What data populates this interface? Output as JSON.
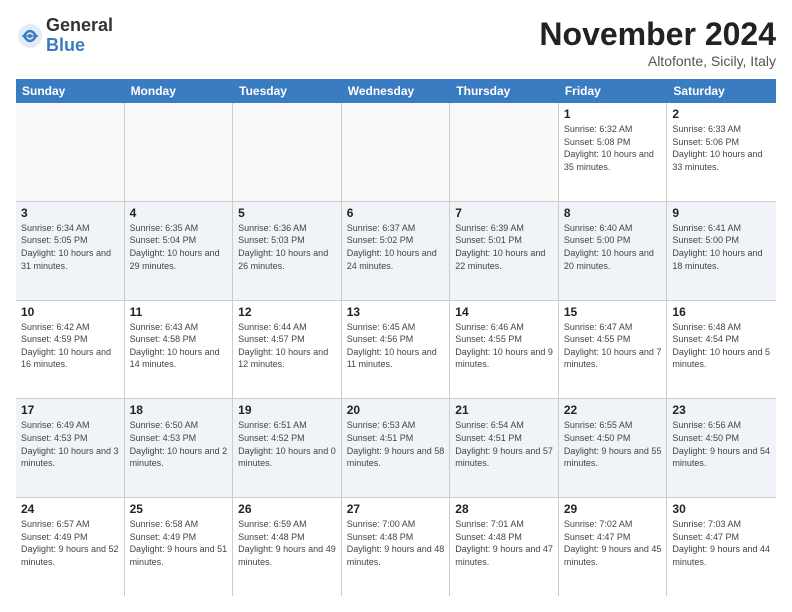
{
  "logo": {
    "general": "General",
    "blue": "Blue"
  },
  "title": "November 2024",
  "location": "Altofonte, Sicily, Italy",
  "weekdays": [
    "Sunday",
    "Monday",
    "Tuesday",
    "Wednesday",
    "Thursday",
    "Friday",
    "Saturday"
  ],
  "rows": [
    [
      {
        "day": "",
        "info": "",
        "empty": true
      },
      {
        "day": "",
        "info": "",
        "empty": true
      },
      {
        "day": "",
        "info": "",
        "empty": true
      },
      {
        "day": "",
        "info": "",
        "empty": true
      },
      {
        "day": "",
        "info": "",
        "empty": true
      },
      {
        "day": "1",
        "info": "Sunrise: 6:32 AM\nSunset: 5:08 PM\nDaylight: 10 hours and 35 minutes.",
        "empty": false
      },
      {
        "day": "2",
        "info": "Sunrise: 6:33 AM\nSunset: 5:06 PM\nDaylight: 10 hours and 33 minutes.",
        "empty": false
      }
    ],
    [
      {
        "day": "3",
        "info": "Sunrise: 6:34 AM\nSunset: 5:05 PM\nDaylight: 10 hours and 31 minutes.",
        "empty": false
      },
      {
        "day": "4",
        "info": "Sunrise: 6:35 AM\nSunset: 5:04 PM\nDaylight: 10 hours and 29 minutes.",
        "empty": false
      },
      {
        "day": "5",
        "info": "Sunrise: 6:36 AM\nSunset: 5:03 PM\nDaylight: 10 hours and 26 minutes.",
        "empty": false
      },
      {
        "day": "6",
        "info": "Sunrise: 6:37 AM\nSunset: 5:02 PM\nDaylight: 10 hours and 24 minutes.",
        "empty": false
      },
      {
        "day": "7",
        "info": "Sunrise: 6:39 AM\nSunset: 5:01 PM\nDaylight: 10 hours and 22 minutes.",
        "empty": false
      },
      {
        "day": "8",
        "info": "Sunrise: 6:40 AM\nSunset: 5:00 PM\nDaylight: 10 hours and 20 minutes.",
        "empty": false
      },
      {
        "day": "9",
        "info": "Sunrise: 6:41 AM\nSunset: 5:00 PM\nDaylight: 10 hours and 18 minutes.",
        "empty": false
      }
    ],
    [
      {
        "day": "10",
        "info": "Sunrise: 6:42 AM\nSunset: 4:59 PM\nDaylight: 10 hours and 16 minutes.",
        "empty": false
      },
      {
        "day": "11",
        "info": "Sunrise: 6:43 AM\nSunset: 4:58 PM\nDaylight: 10 hours and 14 minutes.",
        "empty": false
      },
      {
        "day": "12",
        "info": "Sunrise: 6:44 AM\nSunset: 4:57 PM\nDaylight: 10 hours and 12 minutes.",
        "empty": false
      },
      {
        "day": "13",
        "info": "Sunrise: 6:45 AM\nSunset: 4:56 PM\nDaylight: 10 hours and 11 minutes.",
        "empty": false
      },
      {
        "day": "14",
        "info": "Sunrise: 6:46 AM\nSunset: 4:55 PM\nDaylight: 10 hours and 9 minutes.",
        "empty": false
      },
      {
        "day": "15",
        "info": "Sunrise: 6:47 AM\nSunset: 4:55 PM\nDaylight: 10 hours and 7 minutes.",
        "empty": false
      },
      {
        "day": "16",
        "info": "Sunrise: 6:48 AM\nSunset: 4:54 PM\nDaylight: 10 hours and 5 minutes.",
        "empty": false
      }
    ],
    [
      {
        "day": "17",
        "info": "Sunrise: 6:49 AM\nSunset: 4:53 PM\nDaylight: 10 hours and 3 minutes.",
        "empty": false
      },
      {
        "day": "18",
        "info": "Sunrise: 6:50 AM\nSunset: 4:53 PM\nDaylight: 10 hours and 2 minutes.",
        "empty": false
      },
      {
        "day": "19",
        "info": "Sunrise: 6:51 AM\nSunset: 4:52 PM\nDaylight: 10 hours and 0 minutes.",
        "empty": false
      },
      {
        "day": "20",
        "info": "Sunrise: 6:53 AM\nSunset: 4:51 PM\nDaylight: 9 hours and 58 minutes.",
        "empty": false
      },
      {
        "day": "21",
        "info": "Sunrise: 6:54 AM\nSunset: 4:51 PM\nDaylight: 9 hours and 57 minutes.",
        "empty": false
      },
      {
        "day": "22",
        "info": "Sunrise: 6:55 AM\nSunset: 4:50 PM\nDaylight: 9 hours and 55 minutes.",
        "empty": false
      },
      {
        "day": "23",
        "info": "Sunrise: 6:56 AM\nSunset: 4:50 PM\nDaylight: 9 hours and 54 minutes.",
        "empty": false
      }
    ],
    [
      {
        "day": "24",
        "info": "Sunrise: 6:57 AM\nSunset: 4:49 PM\nDaylight: 9 hours and 52 minutes.",
        "empty": false
      },
      {
        "day": "25",
        "info": "Sunrise: 6:58 AM\nSunset: 4:49 PM\nDaylight: 9 hours and 51 minutes.",
        "empty": false
      },
      {
        "day": "26",
        "info": "Sunrise: 6:59 AM\nSunset: 4:48 PM\nDaylight: 9 hours and 49 minutes.",
        "empty": false
      },
      {
        "day": "27",
        "info": "Sunrise: 7:00 AM\nSunset: 4:48 PM\nDaylight: 9 hours and 48 minutes.",
        "empty": false
      },
      {
        "day": "28",
        "info": "Sunrise: 7:01 AM\nSunset: 4:48 PM\nDaylight: 9 hours and 47 minutes.",
        "empty": false
      },
      {
        "day": "29",
        "info": "Sunrise: 7:02 AM\nSunset: 4:47 PM\nDaylight: 9 hours and 45 minutes.",
        "empty": false
      },
      {
        "day": "30",
        "info": "Sunrise: 7:03 AM\nSunset: 4:47 PM\nDaylight: 9 hours and 44 minutes.",
        "empty": false
      }
    ]
  ]
}
